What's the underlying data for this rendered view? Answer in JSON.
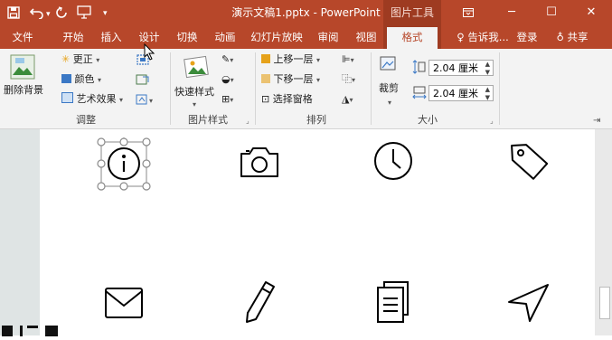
{
  "titlebar": {
    "title": "演示文稿1.pptx - PowerPoint",
    "context_tab_group": "图片工具",
    "save_icon": "save-icon",
    "undo_icon": "undo-icon",
    "redo_icon": "redo-icon",
    "customize_icon": "customize-qat-icon",
    "window_controls": [
      "ribbon-display-icon",
      "minimize-icon",
      "maximize-icon",
      "close-icon"
    ]
  },
  "tabs": [
    {
      "label": "文件",
      "active": false
    },
    {
      "label": "开始",
      "active": false
    },
    {
      "label": "插入",
      "active": false
    },
    {
      "label": "设计",
      "active": false
    },
    {
      "label": "切换",
      "active": false
    },
    {
      "label": "动画",
      "active": false
    },
    {
      "label": "幻灯片放映",
      "active": false
    },
    {
      "label": "审阅",
      "active": false
    },
    {
      "label": "视图",
      "active": false
    },
    {
      "label": "格式",
      "active": true
    }
  ],
  "tellme": "告诉我...",
  "login": "登录",
  "share": "共享",
  "ribbon": {
    "adjust": {
      "group_label": "调整",
      "remove_bg": "删除背景",
      "corrections": "更正",
      "color": "颜色",
      "artistic": "艺术效果"
    },
    "picture_styles": {
      "group_label": "图片样式",
      "quick_styles": "快速样式"
    },
    "arrange": {
      "group_label": "排列",
      "bring_forward": "上移一层",
      "send_backward": "下移一层",
      "selection_pane": "选择窗格"
    },
    "size": {
      "group_label": "大小",
      "crop": "裁剪",
      "height": "2.04 厘米",
      "width": "2.04 厘米"
    }
  },
  "slide": {
    "icons": [
      "info-icon",
      "camera-icon",
      "clock-icon",
      "tag-icon",
      "mail-icon",
      "pencil-icon",
      "clipboard-icon",
      "send-icon"
    ],
    "selected_icon": "info-icon"
  },
  "colors": {
    "accent": "#b7472a",
    "context_accent": "#9e3b21",
    "ribbon_bg": "#f3f3f3"
  }
}
